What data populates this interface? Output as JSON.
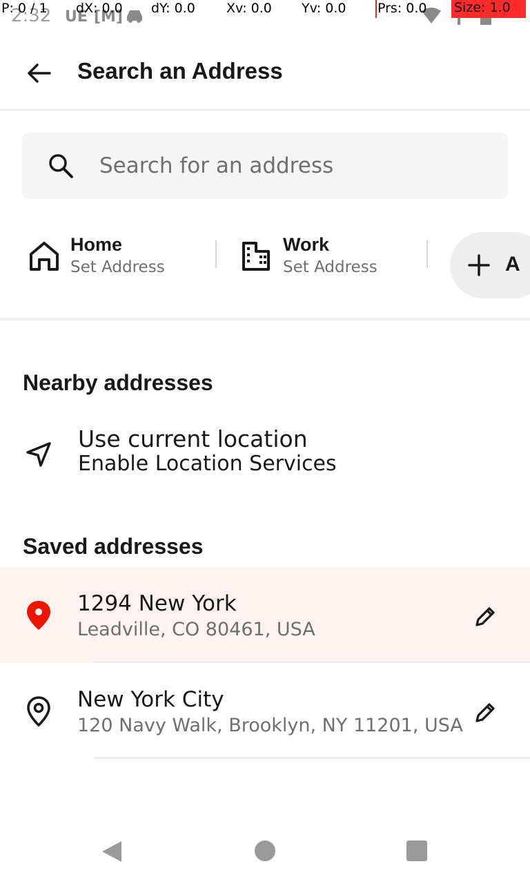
{
  "status_bar": {
    "time": "2:32",
    "notification_glyphs": [
      "UE",
      "[M]"
    ]
  },
  "pointer_overlay": {
    "p": "P: 0 / 1",
    "dx": "dX: 0.0",
    "dy": "dY: 0.0",
    "xv": "Xv: 0.0",
    "yv": "Yv: 0.0",
    "prs": "Prs: 0.0",
    "size": "Size: 1.0"
  },
  "header": {
    "title": "Search an Address"
  },
  "search": {
    "placeholder": "Search for an address",
    "value": ""
  },
  "shortcuts": {
    "home": {
      "title": "Home",
      "subtitle": "Set Address",
      "icon": "home-icon"
    },
    "work": {
      "title": "Work",
      "subtitle": "Set Address",
      "icon": "building-icon"
    },
    "add": {
      "label": "A",
      "icon": "plus-icon"
    }
  },
  "nearby": {
    "heading": "Nearby addresses",
    "current_location": {
      "title": "Use current location",
      "subtitle": "Enable Location Services",
      "icon": "navigation-arrow-icon"
    }
  },
  "saved": {
    "heading": "Saved addresses",
    "items": [
      {
        "name": "1294 New York",
        "detail": "Leadville, CO 80461, USA",
        "selected": true,
        "icon": "location-pin-filled-icon"
      },
      {
        "name": "New York City",
        "detail": "120 Navy Walk, Brooklyn, NY 11201, USA",
        "selected": false,
        "icon": "location-pin-outline-icon"
      }
    ]
  },
  "colors": {
    "accent_red": "#eb1700",
    "selected_row_bg": "#fff3f1",
    "search_bg": "#f5f5f5",
    "text_primary": "#191919",
    "text_secondary": "#6f6f6f"
  }
}
